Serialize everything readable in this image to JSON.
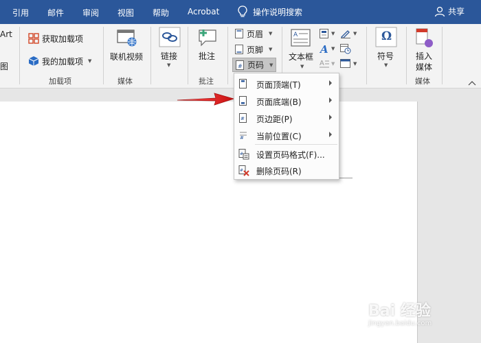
{
  "tabs": {
    "references": "引用",
    "mailings": "邮件",
    "review": "审阅",
    "view": "视图",
    "help": "帮助",
    "acrobat": "Acrobat",
    "tell_me": "操作说明搜索",
    "share": "共享"
  },
  "ribbon": {
    "smartart_partial": "Art",
    "picture_partial": "图",
    "get_addins": "获取加载项",
    "my_addins": "我的加载项",
    "addins_group": "加载项",
    "online_video": "联机视频",
    "media_group": "媒体",
    "link": "链接",
    "comment": "批注",
    "comment_group": "批注",
    "header": "页眉",
    "footer": "页脚",
    "page_number": "页码",
    "textbox": "文本框",
    "symbol": "符号",
    "insert_media_line1": "插入",
    "insert_media_line2": "媒体",
    "media_group2": "媒体",
    "symbol_icon_text": "Ω"
  },
  "menu": {
    "items": [
      {
        "label": "页面顶端(T)",
        "submenu": true
      },
      {
        "label": "页面底端(B)",
        "submenu": true
      },
      {
        "label": "页边距(P)",
        "submenu": true
      },
      {
        "label": "当前位置(C)",
        "submenu": true
      },
      {
        "label": "设置页码格式(F)...",
        "submenu": false
      },
      {
        "label": "删除页码(R)",
        "submenu": false
      }
    ]
  },
  "watermark": {
    "brand": "Bai 经验",
    "url": "jingyan.baidu.com"
  },
  "colors": {
    "tab_bar": "#2b579a",
    "ribbon": "#f3f3f3",
    "arrow": "#e02020",
    "delete_x": "#d23a2a"
  }
}
